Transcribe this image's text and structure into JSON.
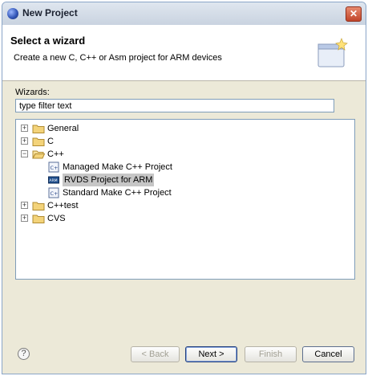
{
  "window": {
    "title": "New Project",
    "close_glyph": "✕"
  },
  "header": {
    "title": "Select a wizard",
    "description": "Create a new C, C++ or Asm project for ARM devices",
    "icon": "wizard-banner-icon"
  },
  "wizards": {
    "label": "Wizards:",
    "filter_value": "type filter text",
    "tree": [
      {
        "label": "General",
        "expanded": false,
        "icon": "folder-icon"
      },
      {
        "label": "C",
        "expanded": false,
        "icon": "folder-icon"
      },
      {
        "label": "C++",
        "expanded": true,
        "icon": "folder-icon",
        "children": [
          {
            "label": "Managed Make C++ Project",
            "icon": "cpp-file-icon"
          },
          {
            "label": "RVDS Project for ARM",
            "icon": "arm-project-icon",
            "selected": true
          },
          {
            "label": "Standard Make C++ Project",
            "icon": "cpp-file-icon"
          }
        ]
      },
      {
        "label": "C++test",
        "expanded": false,
        "icon": "folder-icon"
      },
      {
        "label": "CVS",
        "expanded": false,
        "icon": "folder-icon"
      }
    ]
  },
  "buttons": {
    "help_glyph": "?",
    "back": "< Back",
    "next": "Next >",
    "finish": "Finish",
    "cancel": "Cancel"
  },
  "colors": {
    "selection": "#c6c6c6",
    "folder": "#f3d37a"
  }
}
